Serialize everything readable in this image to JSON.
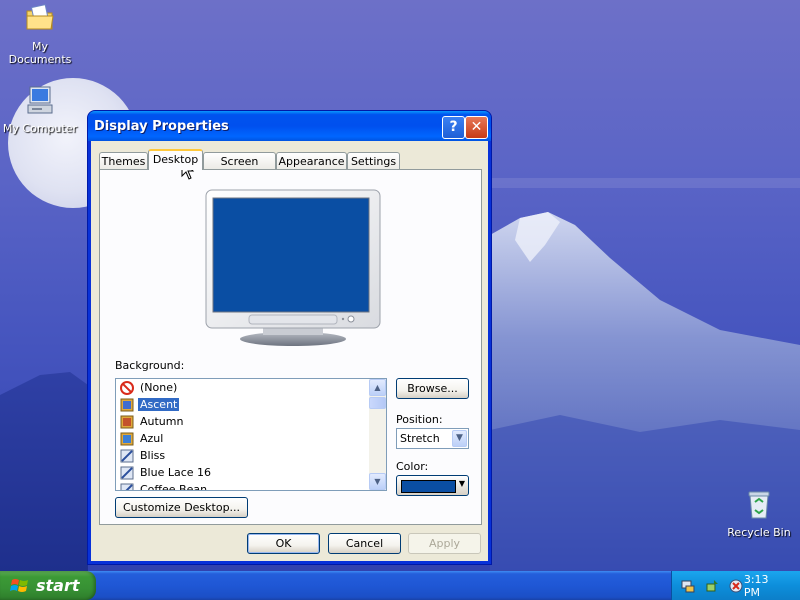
{
  "desktop": {
    "icons": [
      {
        "label": "My Documents",
        "icon": "folder-documents-icon"
      },
      {
        "label": "My Computer",
        "icon": "computer-icon"
      },
      {
        "label": "Recycle Bin",
        "icon": "recycle-bin-icon"
      }
    ]
  },
  "dialog": {
    "title": "Display Properties",
    "help_symbol": "?",
    "close_symbol": "✕",
    "tabs": [
      {
        "label": "Themes",
        "active": false
      },
      {
        "label": "Desktop",
        "active": true
      },
      {
        "label": "Screen Saver",
        "active": false
      },
      {
        "label": "Appearance",
        "active": false
      },
      {
        "label": "Settings",
        "active": false
      }
    ],
    "background_label": "Background:",
    "background_items": [
      {
        "label": "(None)",
        "icon": "none-icon",
        "selected": false
      },
      {
        "label": "Ascent",
        "icon": "image-icon",
        "selected": true
      },
      {
        "label": "Autumn",
        "icon": "image-icon",
        "selected": false
      },
      {
        "label": "Azul",
        "icon": "image-icon",
        "selected": false
      },
      {
        "label": "Bliss",
        "icon": "pattern-icon",
        "selected": false
      },
      {
        "label": "Blue Lace 16",
        "icon": "pattern-icon",
        "selected": false
      },
      {
        "label": "Coffee Bean",
        "icon": "pattern-icon",
        "selected": false
      }
    ],
    "browse_label": "Browse...",
    "position_label": "Position:",
    "position_value": "Stretch",
    "color_label": "Color:",
    "color_value": "#0a4ea3",
    "customize_label": "Customize Desktop...",
    "ok_label": "OK",
    "cancel_label": "Cancel",
    "apply_label": "Apply"
  },
  "taskbar": {
    "start_label": "start",
    "clock": "3:13 PM",
    "tray_icons": [
      "network-icon",
      "safely-remove-icon",
      "security-icon"
    ]
  }
}
